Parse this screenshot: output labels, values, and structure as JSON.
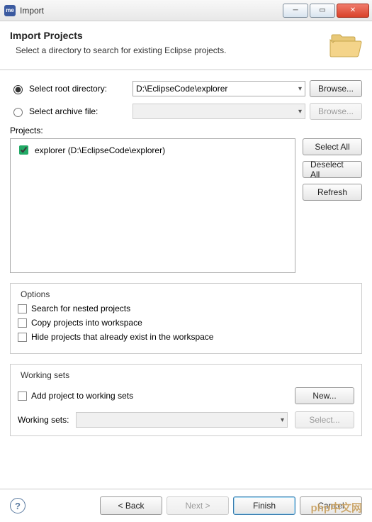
{
  "window": {
    "app_icon_text": "me",
    "title": "Import"
  },
  "banner": {
    "heading": "Import Projects",
    "subtext": "Select a directory to search for existing Eclipse projects."
  },
  "source": {
    "root_radio_label": "Select root directory:",
    "root_value": "D:\\EclipseCode\\explorer",
    "root_browse": "Browse...",
    "archive_radio_label": "Select archive file:",
    "archive_value": "",
    "archive_browse": "Browse..."
  },
  "projects": {
    "label": "Projects:",
    "items": [
      {
        "label": "explorer (D:\\EclipseCode\\explorer)",
        "checked": true
      }
    ],
    "select_all": "Select All",
    "deselect_all": "Deselect All",
    "refresh": "Refresh"
  },
  "options": {
    "legend": "Options",
    "nested": "Search for nested projects",
    "copy": "Copy projects into workspace",
    "hide": "Hide projects that already exist in the workspace"
  },
  "working_sets": {
    "legend": "Working sets",
    "add_label": "Add project to working sets",
    "new_btn": "New...",
    "ws_label": "Working sets:",
    "select_btn": "Select..."
  },
  "footer": {
    "back": "< Back",
    "next": "Next >",
    "finish": "Finish",
    "cancel": "Cancel"
  },
  "watermark": "php中文网"
}
